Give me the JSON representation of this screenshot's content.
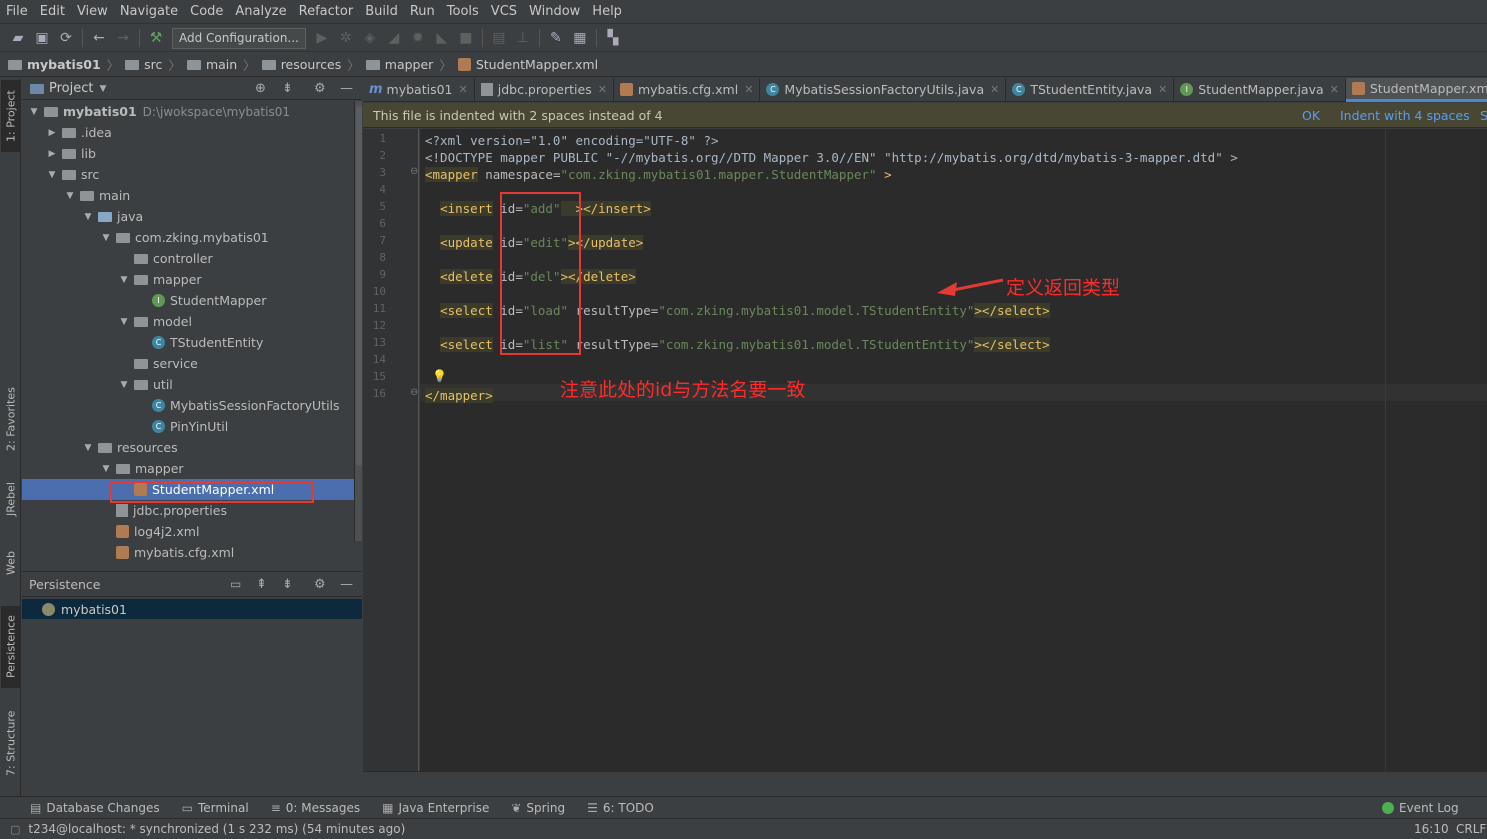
{
  "menu": [
    "File",
    "Edit",
    "View",
    "Navigate",
    "Code",
    "Analyze",
    "Refactor",
    "Build",
    "Run",
    "Tools",
    "VCS",
    "Window",
    "Help"
  ],
  "toolbar": {
    "add_config": "Add Configuration..."
  },
  "breadcrumb": [
    "mybatis01",
    "src",
    "main",
    "resources",
    "mapper",
    "StudentMapper.xml"
  ],
  "left_tools": {
    "project": "1: Project",
    "favorites": "2: Favorites",
    "jrebel": "JRebel",
    "web": "Web",
    "persistence": "Persistence",
    "structure": "7: Structure"
  },
  "project_panel": {
    "title": "Project"
  },
  "tree": [
    {
      "label": "mybatis01",
      "path": "D:\\jwokspace\\mybatis01",
      "depth": 0,
      "arrow": "down",
      "icon": "folder"
    },
    {
      "label": ".idea",
      "depth": 1,
      "arrow": "right",
      "icon": "folder"
    },
    {
      "label": "lib",
      "depth": 1,
      "arrow": "right",
      "icon": "folder"
    },
    {
      "label": "src",
      "depth": 1,
      "arrow": "down",
      "icon": "folder"
    },
    {
      "label": "main",
      "depth": 2,
      "arrow": "down",
      "icon": "folder"
    },
    {
      "label": "java",
      "depth": 3,
      "arrow": "down",
      "icon": "folder-blue"
    },
    {
      "label": "com.zking.mybatis01",
      "depth": 4,
      "arrow": "down",
      "icon": "package"
    },
    {
      "label": "controller",
      "depth": 5,
      "arrow": "",
      "icon": "package"
    },
    {
      "label": "mapper",
      "depth": 5,
      "arrow": "down",
      "icon": "package"
    },
    {
      "label": "StudentMapper",
      "depth": 6,
      "arrow": "",
      "icon": "interface"
    },
    {
      "label": "model",
      "depth": 5,
      "arrow": "down",
      "icon": "package"
    },
    {
      "label": "TStudentEntity",
      "depth": 6,
      "arrow": "",
      "icon": "class"
    },
    {
      "label": "service",
      "depth": 5,
      "arrow": "",
      "icon": "package"
    },
    {
      "label": "util",
      "depth": 5,
      "arrow": "down",
      "icon": "package"
    },
    {
      "label": "MybatisSessionFactoryUtils",
      "depth": 6,
      "arrow": "",
      "icon": "class"
    },
    {
      "label": "PinYinUtil",
      "depth": 6,
      "arrow": "",
      "icon": "class"
    },
    {
      "label": "resources",
      "depth": 3,
      "arrow": "down",
      "icon": "folder-res"
    },
    {
      "label": "mapper",
      "depth": 4,
      "arrow": "down",
      "icon": "folder"
    },
    {
      "label": "StudentMapper.xml",
      "depth": 5,
      "arrow": "",
      "icon": "xml",
      "selected": true
    },
    {
      "label": "jdbc.properties",
      "depth": 4,
      "arrow": "",
      "icon": "properties"
    },
    {
      "label": "log4j2.xml",
      "depth": 4,
      "arrow": "",
      "icon": "xml"
    },
    {
      "label": "mybatis.cfg.xml",
      "depth": 4,
      "arrow": "",
      "icon": "xml"
    }
  ],
  "persistence": {
    "title": "Persistence",
    "item": "mybatis01"
  },
  "tabs": [
    {
      "label": "mybatis01",
      "icon": "m"
    },
    {
      "label": "jdbc.properties",
      "icon": "properties"
    },
    {
      "label": "mybatis.cfg.xml",
      "icon": "xml"
    },
    {
      "label": "MybatisSessionFactoryUtils.java",
      "icon": "class"
    },
    {
      "label": "TStudentEntity.java",
      "icon": "class"
    },
    {
      "label": "StudentMapper.java",
      "icon": "interface"
    },
    {
      "label": "StudentMapper.xml",
      "icon": "xml",
      "active": true
    }
  ],
  "banner": {
    "message": "This file is indented with 2 spaces instead of 4",
    "ok": "OK",
    "indent4": "Indent with 4 spaces",
    "extra": "S"
  },
  "code_lines": [
    [
      [
        "pl",
        "<?xml version=\"1.0\" encoding=\"UTF-8\" ?>"
      ]
    ],
    [
      [
        "pl",
        "<!DOCTYPE mapper PUBLIC \"-//mybatis.org//DTD Mapper 3.0//EN\" \"http://mybatis.org/dtd/mybatis-3-mapper.dtd\" >"
      ]
    ],
    [
      [
        "tgb",
        "<mapper"
      ],
      [
        "at",
        " namespace="
      ],
      [
        "vl",
        "\"com.zking.mybatis01.mapper.StudentMapper\""
      ],
      [
        "tg",
        " >"
      ]
    ],
    [],
    [
      [
        "pl",
        "  "
      ],
      [
        "tgb",
        "<insert"
      ],
      [
        "at",
        " id="
      ],
      [
        "vl",
        "\"add\""
      ],
      [
        "tgb",
        "  ></insert>"
      ]
    ],
    [],
    [
      [
        "pl",
        "  "
      ],
      [
        "tgb",
        "<update"
      ],
      [
        "at",
        " id="
      ],
      [
        "vl",
        "\"edit\""
      ],
      [
        "tgb",
        "></update>"
      ]
    ],
    [],
    [
      [
        "pl",
        "  "
      ],
      [
        "tgb",
        "<delete"
      ],
      [
        "at",
        " id="
      ],
      [
        "vl",
        "\"del\""
      ],
      [
        "tgb",
        "></delete>"
      ]
    ],
    [],
    [
      [
        "pl",
        "  "
      ],
      [
        "tgb",
        "<select"
      ],
      [
        "at",
        " id="
      ],
      [
        "vl",
        "\"load\""
      ],
      [
        "at",
        " resultType="
      ],
      [
        "vl",
        "\"com.zking.mybatis01.model.TStudentEntity\""
      ],
      [
        "tgb",
        "></select>"
      ]
    ],
    [],
    [
      [
        "pl",
        "  "
      ],
      [
        "tgb",
        "<select"
      ],
      [
        "at",
        " id="
      ],
      [
        "vl",
        "\"list\""
      ],
      [
        "at",
        " resultType="
      ],
      [
        "vl",
        "\"com.zking.mybatis01.model.TStudentEntity\""
      ],
      [
        "tgb",
        "></select>"
      ]
    ],
    [],
    [],
    [
      [
        "tgb",
        "</mapper>"
      ]
    ]
  ],
  "annotations": {
    "return_type": "定义返回类型",
    "id_note": "注意此处的id与方法名要一致"
  },
  "bottom_tools": [
    {
      "label": "Database Changes"
    },
    {
      "label": "Terminal"
    },
    {
      "label": "0: Messages"
    },
    {
      "label": "Java Enterprise"
    },
    {
      "label": "Spring"
    },
    {
      "label": "6: TODO"
    }
  ],
  "event_log": "Event Log",
  "status": {
    "message": "t234@localhost: * synchronized (1 s 232 ms) (54 minutes ago)",
    "position": "16:10",
    "line_sep": "CRLF"
  },
  "colors": {
    "accent": "#4b6eaf",
    "annotation": "#ff2a2a",
    "banner_bg": "#474733"
  }
}
